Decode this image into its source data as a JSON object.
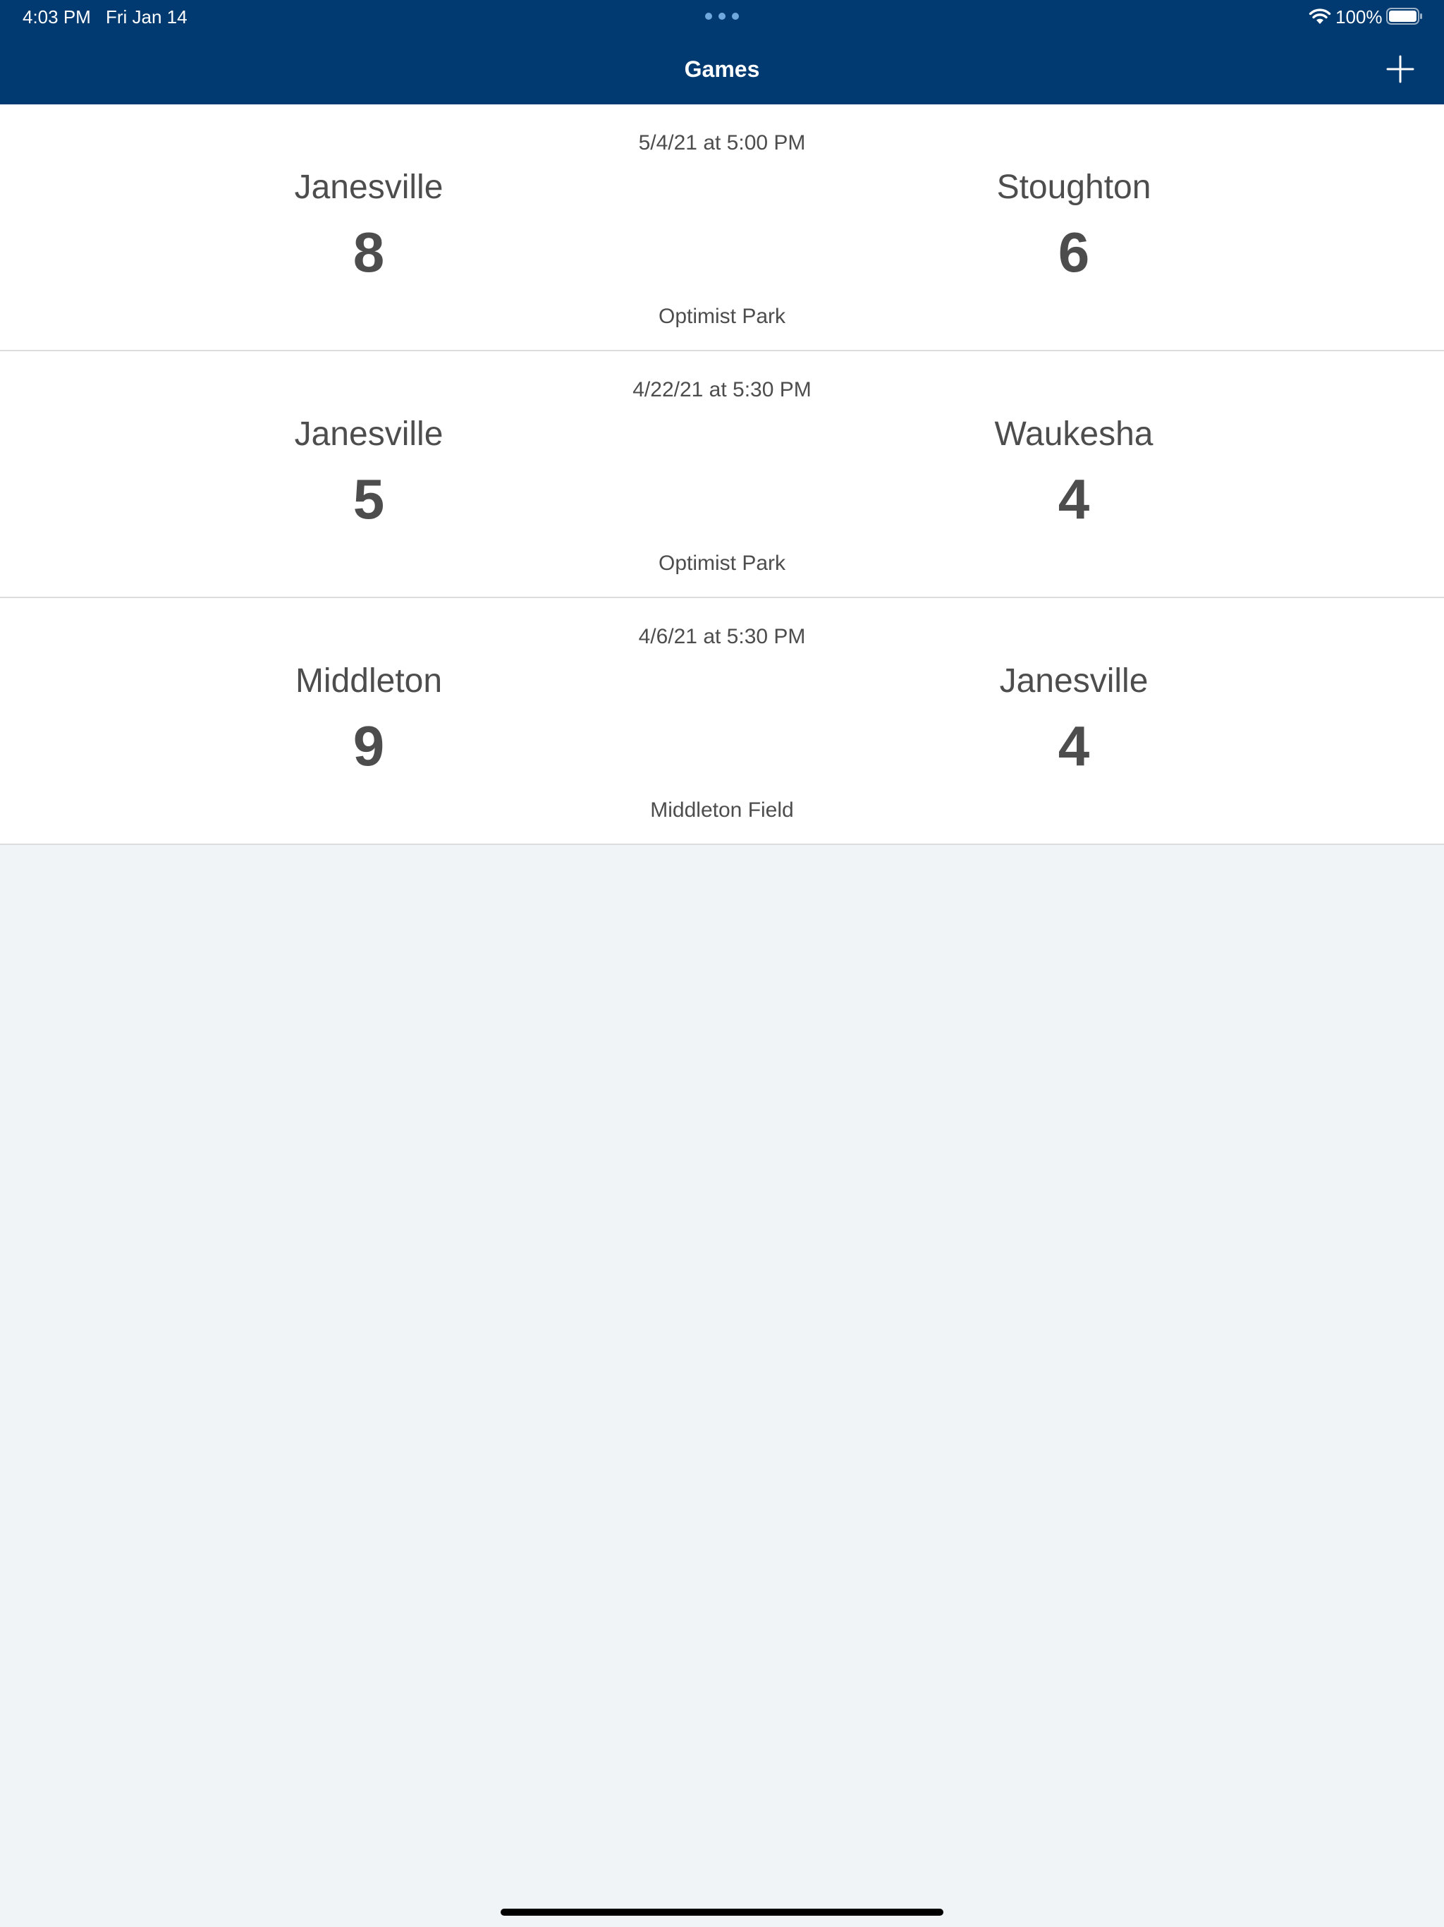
{
  "status_bar": {
    "time": "4:03 PM",
    "date": "Fri Jan 14",
    "battery": "100%",
    "icons": [
      "wifi-icon",
      "battery-icon",
      "multitasking-dots-icon"
    ]
  },
  "nav": {
    "title": "Games",
    "add_icon": "plus-icon"
  },
  "colors": {
    "nav_background": "#003a70",
    "page_background": "#f1f4f7",
    "row_background": "#ffffff",
    "text": "#4d4d4d"
  },
  "games": [
    {
      "datetime": "5/4/21 at 5:00 PM",
      "team_left": "Janesville",
      "score_left": "8",
      "team_right": "Stoughton",
      "score_right": "6",
      "venue": "Optimist Park"
    },
    {
      "datetime": "4/22/21 at 5:30 PM",
      "team_left": "Janesville",
      "score_left": "5",
      "team_right": "Waukesha",
      "score_right": "4",
      "venue": "Optimist Park"
    },
    {
      "datetime": "4/6/21 at 5:30 PM",
      "team_left": "Middleton",
      "score_left": "9",
      "team_right": "Janesville",
      "score_right": "4",
      "venue": "Middleton Field"
    }
  ]
}
